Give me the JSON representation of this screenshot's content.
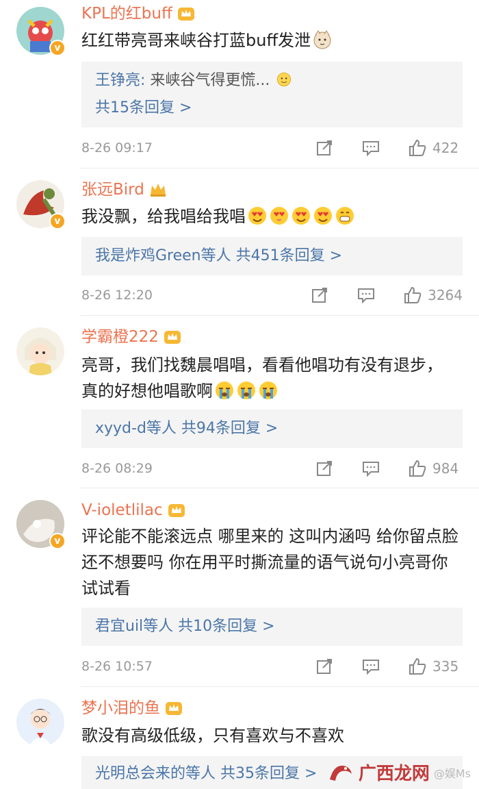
{
  "comments": [
    {
      "name": "KPL的红buff",
      "text": "红红带亮哥来峡谷打蓝buff发泄",
      "reply_lines": [
        {
          "user": "王铮亮:",
          "quote": " 来峡谷气得更慌...",
          "emoji": "smile"
        },
        {
          "more": "共15条回复 >"
        }
      ],
      "time": "8-26 09:17",
      "likes": "422"
    },
    {
      "name": "张远Bird",
      "text": "我没飘，给我唱给我唱",
      "reply_lines": [
        {
          "user": "我是炸鸡Green等人",
          "more": "  共451条回复 >"
        }
      ],
      "time": "8-26 12:20",
      "likes": "3264"
    },
    {
      "name": "学霸橙222",
      "text": "亮哥，我们找魏晨唱唱，看看他唱功有没有退步，真的好想他唱歌啊",
      "reply_lines": [
        {
          "user": "xyyd-d等人",
          "more": "  共94条回复 >"
        }
      ],
      "time": "8-26 08:29",
      "likes": "984"
    },
    {
      "name": "V-ioletlilac",
      "text": "评论能不能滚远点 哪里来的 这叫内涵吗 给你留点脸还不想要吗 你在用平时撕流量的语气说句小亮哥你试试看",
      "reply_lines": [
        {
          "user": "君宜uil等人",
          "more": "  共10条回复 >"
        }
      ],
      "time": "8-26 10:57",
      "likes": "335"
    },
    {
      "name": "梦小泪的鱼",
      "text": "歌没有高级低级，只有喜欢与不喜欢",
      "reply_lines": [
        {
          "user": "光明总会来的等人",
          "more": "  共35条回复 >"
        }
      ]
    }
  ],
  "watermark": {
    "brand": "广西龙网",
    "sub": "@娱Ms"
  },
  "colors": {
    "name": "#eb7350",
    "link": "#4b76a8",
    "meta": "#999999",
    "reply_bg": "#f4f4f4"
  },
  "icons": [
    "crown-icon",
    "verified-badge-icon",
    "share-icon",
    "comment-icon",
    "like-icon"
  ]
}
